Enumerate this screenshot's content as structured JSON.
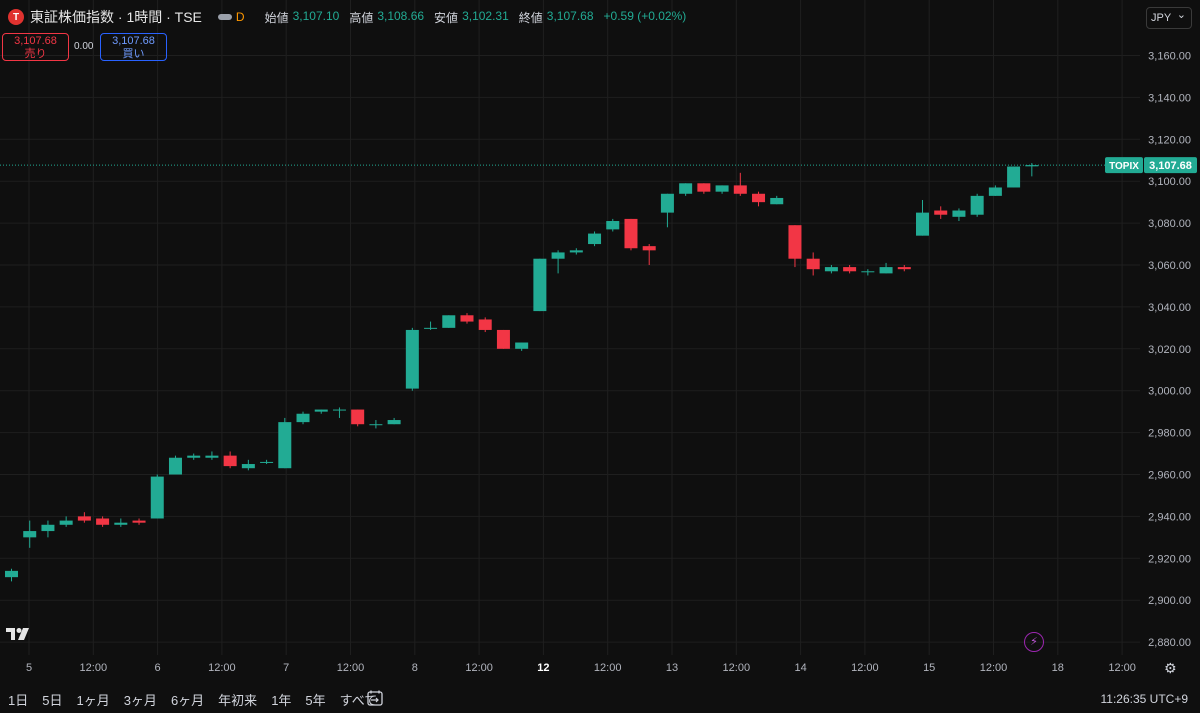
{
  "header": {
    "symbol_logo": "T",
    "symbol_name": "東証株価指数 · 1時間 · TSE",
    "toggle_label": "D",
    "ohlc": [
      {
        "label": "始値",
        "value": "3,107.10"
      },
      {
        "label": "高値",
        "value": "3,108.66"
      },
      {
        "label": "安値",
        "value": "3,102.31"
      },
      {
        "label": "終値",
        "value": "3,107.68"
      },
      {
        "label": "",
        "value": "+0.59 (+0.02%)"
      }
    ]
  },
  "trade": {
    "sell_price": "3,107.68",
    "sell_label": "売り",
    "spread": "0.00",
    "buy_price": "3,107.68",
    "buy_label": "買い"
  },
  "currency": "JPY",
  "price_tag": {
    "symbol": "TOPIX",
    "value": "3,107.68"
  },
  "bottom": {
    "ranges": [
      "1日",
      "5日",
      "1ヶ月",
      "3ヶ月",
      "6ヶ月",
      "年初来",
      "1年",
      "5年",
      "すべて"
    ],
    "clock": "11:26:35 UTC+9"
  },
  "icons": {
    "logo": "tradingview-logo",
    "goto": "goto-date-icon",
    "bolt": "lightning-icon",
    "settings": "gear-icon"
  },
  "colors": {
    "up": "#22ab94",
    "down": "#f23645",
    "grid": "#1f1f1f",
    "bg": "#0f0f0f"
  },
  "chart_data": {
    "type": "candlestick",
    "y_ticks": [
      "3,160.00",
      "3,140.00",
      "3,120.00",
      "3,100.00",
      "3,080.00",
      "3,060.00",
      "3,040.00",
      "3,020.00",
      "3,000.00",
      "2,980.00",
      "2,960.00",
      "2,940.00",
      "2,920.00",
      "2,900.00",
      "2,880.00"
    ],
    "ylim": [
      2880,
      3160
    ],
    "x_ticks": [
      {
        "label": "5",
        "bold": false
      },
      {
        "label": "12:00",
        "bold": false
      },
      {
        "label": "6",
        "bold": false
      },
      {
        "label": "12:00",
        "bold": false
      },
      {
        "label": "7",
        "bold": false
      },
      {
        "label": "12:00",
        "bold": false
      },
      {
        "label": "8",
        "bold": false
      },
      {
        "label": "12:00",
        "bold": false
      },
      {
        "label": "12",
        "bold": true
      },
      {
        "label": "12:00",
        "bold": false
      },
      {
        "label": "13",
        "bold": false
      },
      {
        "label": "12:00",
        "bold": false
      },
      {
        "label": "14",
        "bold": false
      },
      {
        "label": "12:00",
        "bold": false
      },
      {
        "label": "15",
        "bold": false
      },
      {
        "label": "12:00",
        "bold": false
      },
      {
        "label": "18",
        "bold": false
      },
      {
        "label": "12:00",
        "bold": false
      }
    ],
    "last_price": 3107.68,
    "candles": [
      {
        "o": 2911,
        "h": 2915,
        "l": 2909,
        "c": 2914
      },
      {
        "o": 2930,
        "h": 2938,
        "l": 2925,
        "c": 2933
      },
      {
        "o": 2933,
        "h": 2938,
        "l": 2930,
        "c": 2936
      },
      {
        "o": 2936,
        "h": 2940,
        "l": 2935,
        "c": 2938
      },
      {
        "o": 2940,
        "h": 2942,
        "l": 2937,
        "c": 2938
      },
      {
        "o": 2939,
        "h": 2940,
        "l": 2935,
        "c": 2936
      },
      {
        "o": 2936,
        "h": 2939,
        "l": 2935,
        "c": 2937
      },
      {
        "o": 2938,
        "h": 2939,
        "l": 2936,
        "c": 2937
      },
      {
        "o": 2939,
        "h": 2960,
        "l": 2939,
        "c": 2959
      },
      {
        "o": 2960,
        "h": 2969,
        "l": 2960,
        "c": 2968
      },
      {
        "o": 2968,
        "h": 2970,
        "l": 2967,
        "c": 2969
      },
      {
        "o": 2968,
        "h": 2971,
        "l": 2967,
        "c": 2969
      },
      {
        "o": 2969,
        "h": 2971,
        "l": 2963,
        "c": 2964
      },
      {
        "o": 2963,
        "h": 2967,
        "l": 2962,
        "c": 2965
      },
      {
        "o": 2966,
        "h": 2967,
        "l": 2965,
        "c": 2966
      },
      {
        "o": 2963,
        "h": 2987,
        "l": 2963,
        "c": 2985
      },
      {
        "o": 2985,
        "h": 2990,
        "l": 2984,
        "c": 2989
      },
      {
        "o": 2990,
        "h": 2991,
        "l": 2989,
        "c": 2991
      },
      {
        "o": 2991,
        "h": 2992,
        "l": 2987,
        "c": 2991
      },
      {
        "o": 2991,
        "h": 2991,
        "l": 2983,
        "c": 2984
      },
      {
        "o": 2984,
        "h": 2986,
        "l": 2982,
        "c": 2984
      },
      {
        "o": 2984,
        "h": 2987,
        "l": 2984,
        "c": 2986
      },
      {
        "o": 3001,
        "h": 3030,
        "l": 3000,
        "c": 3029
      },
      {
        "o": 3030,
        "h": 3033,
        "l": 3029,
        "c": 3030
      },
      {
        "o": 3030,
        "h": 3036,
        "l": 3030,
        "c": 3036
      },
      {
        "o": 3036,
        "h": 3037,
        "l": 3032,
        "c": 3033
      },
      {
        "o": 3034,
        "h": 3035,
        "l": 3028,
        "c": 3029
      },
      {
        "o": 3029,
        "h": 3029,
        "l": 3020,
        "c": 3020
      },
      {
        "o": 3020,
        "h": 3023,
        "l": 3019,
        "c": 3023
      },
      {
        "o": 3038,
        "h": 3063,
        "l": 3038,
        "c": 3063
      },
      {
        "o": 3063,
        "h": 3067,
        "l": 3056,
        "c": 3066
      },
      {
        "o": 3066,
        "h": 3068,
        "l": 3065,
        "c": 3067
      },
      {
        "o": 3070,
        "h": 3076,
        "l": 3069,
        "c": 3075
      },
      {
        "o": 3077,
        "h": 3082,
        "l": 3076,
        "c": 3081
      },
      {
        "o": 3082,
        "h": 3082,
        "l": 3067,
        "c": 3068
      },
      {
        "o": 3069,
        "h": 3070,
        "l": 3060,
        "c": 3067
      },
      {
        "o": 3085,
        "h": 3094,
        "l": 3078,
        "c": 3094
      },
      {
        "o": 3094,
        "h": 3099,
        "l": 3093,
        "c": 3099
      },
      {
        "o": 3099,
        "h": 3099,
        "l": 3094,
        "c": 3095
      },
      {
        "o": 3095,
        "h": 3098,
        "l": 3094,
        "c": 3098
      },
      {
        "o": 3098,
        "h": 3104,
        "l": 3093,
        "c": 3094
      },
      {
        "o": 3094,
        "h": 3095,
        "l": 3088,
        "c": 3090
      },
      {
        "o": 3089,
        "h": 3093,
        "l": 3089,
        "c": 3092
      },
      {
        "o": 3079,
        "h": 3079,
        "l": 3059,
        "c": 3063
      },
      {
        "o": 3063,
        "h": 3066,
        "l": 3055,
        "c": 3058
      },
      {
        "o": 3057,
        "h": 3060,
        "l": 3056,
        "c": 3059
      },
      {
        "o": 3059,
        "h": 3060,
        "l": 3056,
        "c": 3057
      },
      {
        "o": 3057,
        "h": 3058,
        "l": 3055,
        "c": 3057
      },
      {
        "o": 3056,
        "h": 3061,
        "l": 3056,
        "c": 3059
      },
      {
        "o": 3059,
        "h": 3060,
        "l": 3057,
        "c": 3058
      },
      {
        "o": 3074,
        "h": 3091,
        "l": 3074,
        "c": 3085
      },
      {
        "o": 3086,
        "h": 3088,
        "l": 3082,
        "c": 3084
      },
      {
        "o": 3083,
        "h": 3087,
        "l": 3081,
        "c": 3086
      },
      {
        "o": 3084,
        "h": 3094,
        "l": 3083,
        "c": 3093
      },
      {
        "o": 3093,
        "h": 3098,
        "l": 3093,
        "c": 3097
      },
      {
        "o": 3097,
        "h": 3107,
        "l": 3097,
        "c": 3107
      },
      {
        "o": 3107.1,
        "h": 3108.66,
        "l": 3102.31,
        "c": 3107.68
      }
    ]
  }
}
